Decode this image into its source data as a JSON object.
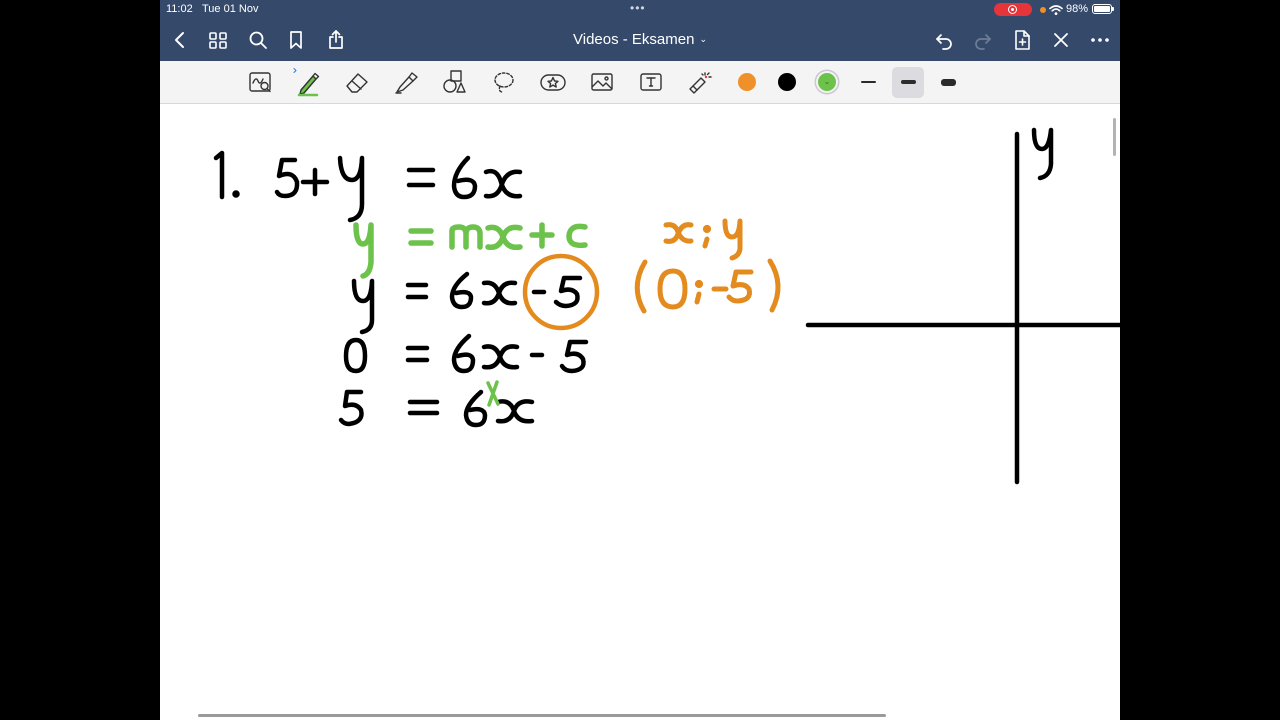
{
  "status_bar": {
    "time": "11:02",
    "date": "Tue 01 Nov",
    "battery": "98%",
    "record_color": "#e5343a"
  },
  "nav": {
    "title": "Videos - Eksamen",
    "title_chevron": "⌄",
    "left_icons": [
      "back-chevron-icon",
      "grid-icon",
      "search-icon",
      "bookmark-icon",
      "share-icon"
    ],
    "right_icons": [
      "undo-icon",
      "redo-icon",
      "add-page-icon",
      "close-icon",
      "more-icon"
    ]
  },
  "toolbar": {
    "tools": [
      "lasso-zoom-icon",
      "pen-icon",
      "eraser-icon",
      "highlighter-icon",
      "shapes-icon",
      "lasso-icon",
      "sticker-icon",
      "image-icon",
      "text-icon",
      "laser-pointer-icon"
    ],
    "active_tool": "pen",
    "colors": [
      "#f0902a",
      "#000000",
      "#6cc24a"
    ],
    "selected_color": "#6cc24a",
    "stroke_widths": [
      "thin",
      "medium",
      "thick"
    ],
    "selected_stroke": "medium"
  },
  "note": {
    "ink_colors": {
      "black": "#000000",
      "green": "#6cc24a",
      "orange": "#e38b1f"
    }
  }
}
